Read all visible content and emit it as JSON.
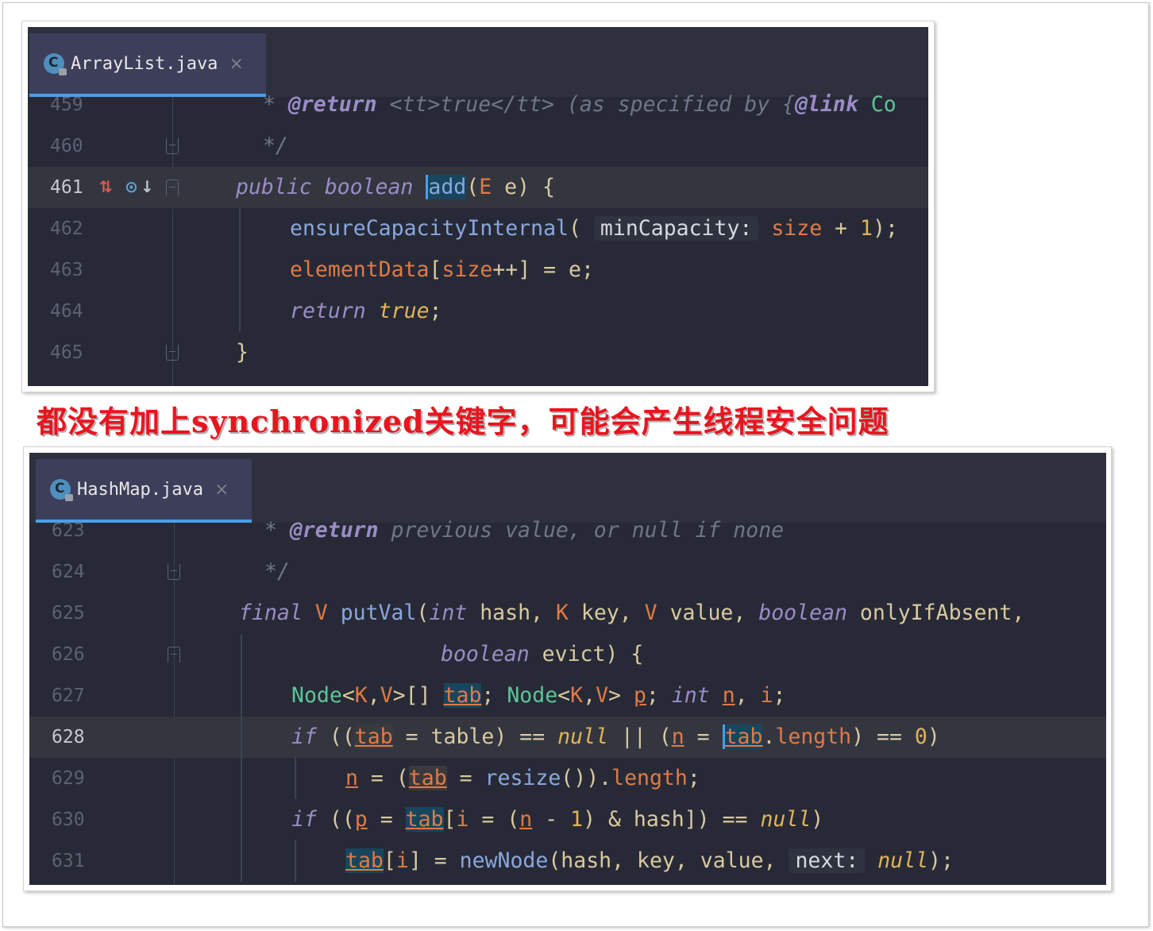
{
  "caption": "都没有加上synchronized关键字，可能会产生线程安全问题",
  "arraylist": {
    "tab_icon_letter": "C",
    "tab_name": "ArrayList.java",
    "tab_close": "×",
    "lines": [
      {
        "num": "459",
        "segments": [
          [
            "cm",
            " * "
          ],
          [
            "tag",
            "@return"
          ],
          [
            "cm",
            " <tt>true</tt> (as specified by {"
          ],
          [
            "tag",
            "@link"
          ],
          [
            "cls",
            " Co"
          ]
        ]
      },
      {
        "num": "460",
        "segments": [
          [
            "cm",
            " */"
          ]
        ]
      },
      {
        "num": "461",
        "segments": [
          [
            "kw",
            "public"
          ],
          [
            "plain",
            " "
          ],
          [
            "kw",
            "boolean"
          ],
          [
            "plain",
            " "
          ],
          [
            "fn caret hl",
            "add"
          ],
          [
            "plain",
            "("
          ],
          [
            "tp",
            "E"
          ],
          [
            "plain",
            " e) {"
          ]
        ]
      },
      {
        "num": "462",
        "segments": [
          [
            "fn",
            "ensureCapacityInternal"
          ],
          [
            "plain",
            "( "
          ],
          [
            "hint",
            "minCapacity:"
          ],
          [
            "plain",
            " "
          ],
          [
            "fld",
            "size"
          ],
          [
            "plain",
            " + "
          ],
          [
            "num",
            "1"
          ],
          [
            "plain",
            ");"
          ]
        ]
      },
      {
        "num": "463",
        "segments": [
          [
            "fld",
            "elementData"
          ],
          [
            "plain",
            "["
          ],
          [
            "fld",
            "size"
          ],
          [
            "plain",
            "++] = e;"
          ]
        ]
      },
      {
        "num": "464",
        "segments": [
          [
            "kw",
            "return"
          ],
          [
            "plain",
            " "
          ],
          [
            "kwb",
            "true"
          ],
          [
            "plain",
            ";"
          ]
        ]
      },
      {
        "num": "465",
        "segments": [
          [
            "plain",
            "}"
          ]
        ]
      }
    ]
  },
  "hashmap": {
    "tab_icon_letter": "C",
    "tab_name": "HashMap.java",
    "tab_close": "×",
    "lines": [
      {
        "num": "623",
        "segments": [
          [
            "cm",
            " * "
          ],
          [
            "tag",
            "@return"
          ],
          [
            "cm",
            " previous value, or null if none"
          ]
        ]
      },
      {
        "num": "624",
        "segments": [
          [
            "cm",
            " */"
          ]
        ]
      },
      {
        "num": "625",
        "segments": [
          [
            "kw",
            "final"
          ],
          [
            "plain",
            " "
          ],
          [
            "tp",
            "V"
          ],
          [
            "plain",
            " "
          ],
          [
            "fn",
            "putVal"
          ],
          [
            "plain",
            "("
          ],
          [
            "kw",
            "int"
          ],
          [
            "plain",
            " hash, "
          ],
          [
            "tp",
            "K"
          ],
          [
            "plain",
            " key, "
          ],
          [
            "tp",
            "V"
          ],
          [
            "plain",
            " value, "
          ],
          [
            "kw",
            "boolean"
          ],
          [
            "plain",
            " onlyIfAbsent,"
          ]
        ]
      },
      {
        "num": "626",
        "segments": [
          [
            "kw",
            "boolean"
          ],
          [
            "plain",
            " evict) {"
          ]
        ]
      },
      {
        "num": "627",
        "segments": [
          [
            "cls",
            "Node"
          ],
          [
            "plain",
            "<"
          ],
          [
            "tp",
            "K"
          ],
          [
            "plain",
            ","
          ],
          [
            "tp",
            "V"
          ],
          [
            "plain",
            ">[] "
          ],
          [
            "var hl",
            "tab"
          ],
          [
            "plain",
            "; "
          ],
          [
            "cls",
            "Node"
          ],
          [
            "plain",
            "<"
          ],
          [
            "tp",
            "K"
          ],
          [
            "plain",
            ","
          ],
          [
            "tp",
            "V"
          ],
          [
            "plain",
            "> "
          ],
          [
            "var",
            "p"
          ],
          [
            "plain",
            "; "
          ],
          [
            "kw",
            "int"
          ],
          [
            "plain",
            " "
          ],
          [
            "var",
            "n"
          ],
          [
            "plain",
            ", "
          ],
          [
            "fld",
            "i"
          ],
          [
            "plain",
            ";"
          ]
        ]
      },
      {
        "num": "628",
        "segments": [
          [
            "kw",
            "if"
          ],
          [
            "plain",
            " (("
          ],
          [
            "var hl2",
            "tab"
          ],
          [
            "plain",
            " = "
          ],
          [
            "plain",
            "table"
          ],
          [
            "plain",
            ") == "
          ],
          [
            "kwb",
            "null"
          ],
          [
            "plain",
            " || ("
          ],
          [
            "var",
            "n"
          ],
          [
            "plain",
            " = "
          ],
          [
            "var hl caret",
            "tab"
          ],
          [
            "plain",
            "."
          ],
          [
            "fld",
            "length"
          ],
          [
            "plain",
            ") == "
          ],
          [
            "num",
            "0"
          ],
          [
            "plain",
            ")"
          ]
        ]
      },
      {
        "num": "629",
        "segments": [
          [
            "var",
            "n"
          ],
          [
            "plain",
            " = ("
          ],
          [
            "var hl2",
            "tab"
          ],
          [
            "plain",
            " = "
          ],
          [
            "fn",
            "resize"
          ],
          [
            "plain",
            "())."
          ],
          [
            "fld",
            "length"
          ],
          [
            "plain",
            ";"
          ]
        ]
      },
      {
        "num": "630",
        "segments": [
          [
            "kw",
            "if"
          ],
          [
            "plain",
            " (("
          ],
          [
            "var",
            "p"
          ],
          [
            "plain",
            " = "
          ],
          [
            "var hl",
            "tab"
          ],
          [
            "plain",
            "["
          ],
          [
            "fld",
            "i"
          ],
          [
            "plain",
            " = ("
          ],
          [
            "var",
            "n"
          ],
          [
            "plain",
            " - "
          ],
          [
            "num",
            "1"
          ],
          [
            "plain",
            ") & hash]) == "
          ],
          [
            "kwb",
            "null"
          ],
          [
            "plain",
            ")"
          ]
        ]
      },
      {
        "num": "631",
        "segments": [
          [
            "var hl",
            "tab"
          ],
          [
            "plain",
            "["
          ],
          [
            "fld",
            "i"
          ],
          [
            "plain",
            "] = "
          ],
          [
            "fn",
            "newNode"
          ],
          [
            "plain",
            "(hash, key, value, "
          ],
          [
            "hint",
            "next:"
          ],
          [
            "plain",
            " "
          ],
          [
            "kwb",
            "null"
          ],
          [
            "plain",
            ");"
          ]
        ]
      }
    ]
  }
}
